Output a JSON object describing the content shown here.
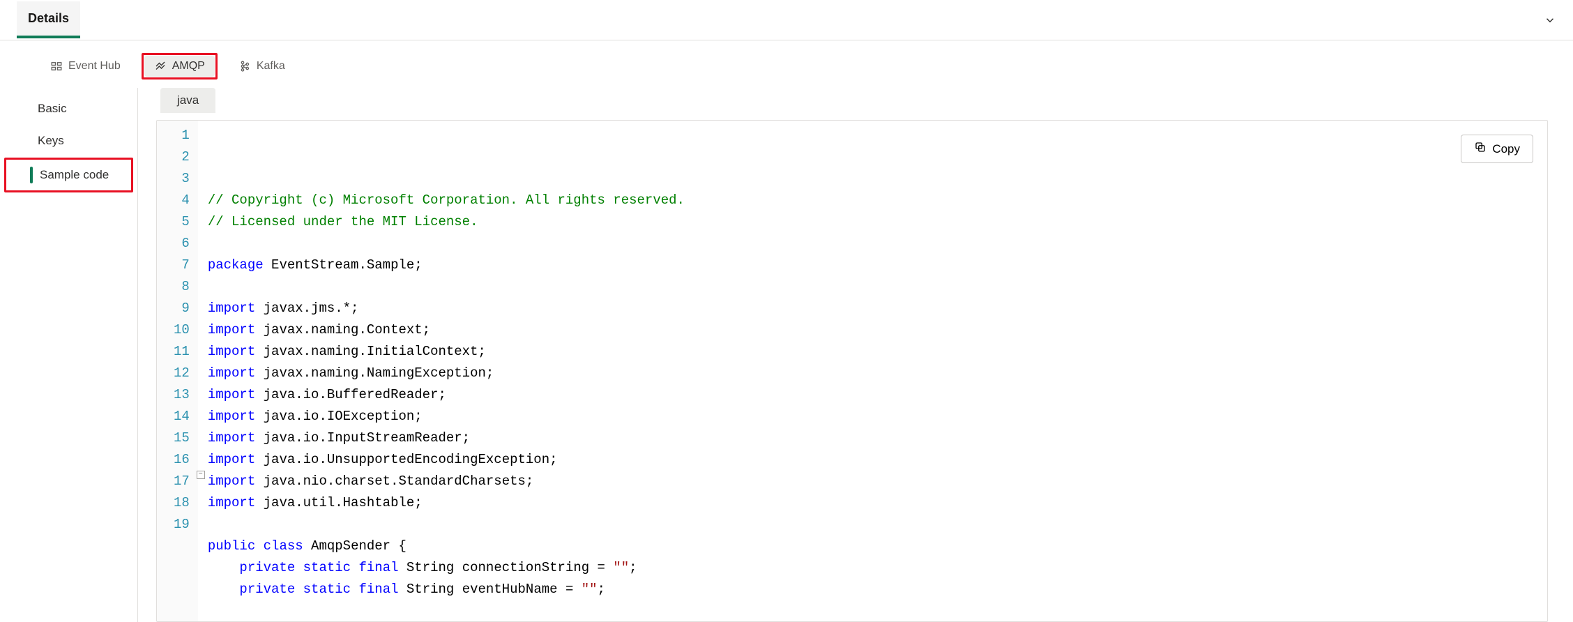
{
  "header": {
    "tab_label": "Details"
  },
  "protocols": {
    "items": [
      {
        "label": "Event Hub"
      },
      {
        "label": "AMQP"
      },
      {
        "label": "Kafka"
      }
    ]
  },
  "sidebar": {
    "items": [
      {
        "label": "Basic"
      },
      {
        "label": "Keys"
      },
      {
        "label": "Sample code"
      }
    ]
  },
  "content": {
    "language_chip": "java",
    "copy_label": "Copy"
  },
  "code": {
    "lines": [
      {
        "n": "1",
        "t": "comment",
        "text": "// Copyright (c) Microsoft Corporation. All rights reserved."
      },
      {
        "n": "2",
        "t": "comment",
        "text": "// Licensed under the MIT License."
      },
      {
        "n": "3",
        "t": "blank",
        "text": ""
      },
      {
        "n": "4",
        "t": "pkg",
        "kw": "package",
        "rest": " EventStream.Sample;"
      },
      {
        "n": "5",
        "t": "blank",
        "text": ""
      },
      {
        "n": "6",
        "t": "imp",
        "kw": "import",
        "rest": " javax.jms.*;"
      },
      {
        "n": "7",
        "t": "imp",
        "kw": "import",
        "rest": " javax.naming.Context;"
      },
      {
        "n": "8",
        "t": "imp",
        "kw": "import",
        "rest": " javax.naming.InitialContext;"
      },
      {
        "n": "9",
        "t": "imp",
        "kw": "import",
        "rest": " javax.naming.NamingException;"
      },
      {
        "n": "10",
        "t": "imp",
        "kw": "import",
        "rest": " java.io.BufferedReader;"
      },
      {
        "n": "11",
        "t": "imp",
        "kw": "import",
        "rest": " java.io.IOException;"
      },
      {
        "n": "12",
        "t": "imp",
        "kw": "import",
        "rest": " java.io.InputStreamReader;"
      },
      {
        "n": "13",
        "t": "imp",
        "kw": "import",
        "rest": " java.io.UnsupportedEncodingException;"
      },
      {
        "n": "14",
        "t": "imp",
        "kw": "import",
        "rest": " java.nio.charset.StandardCharsets;"
      },
      {
        "n": "15",
        "t": "imp",
        "kw": "import",
        "rest": " java.util.Hashtable;"
      },
      {
        "n": "16",
        "t": "blank",
        "text": ""
      },
      {
        "n": "17",
        "t": "cls",
        "kw1": "public",
        "kw2": "class",
        "name": " AmqpSender ",
        "brace": "{"
      },
      {
        "n": "18",
        "t": "field",
        "indent": "    ",
        "kw1": "private",
        "kw2": "static",
        "kw3": "final",
        "type": " String ",
        "name": "connectionString = ",
        "str": "\"\"",
        "end": ";"
      },
      {
        "n": "19",
        "t": "field",
        "indent": "    ",
        "kw1": "private",
        "kw2": "static",
        "kw3": "final",
        "type": " String ",
        "name": "eventHubName = ",
        "str": "\"\"",
        "end": ";"
      }
    ]
  }
}
